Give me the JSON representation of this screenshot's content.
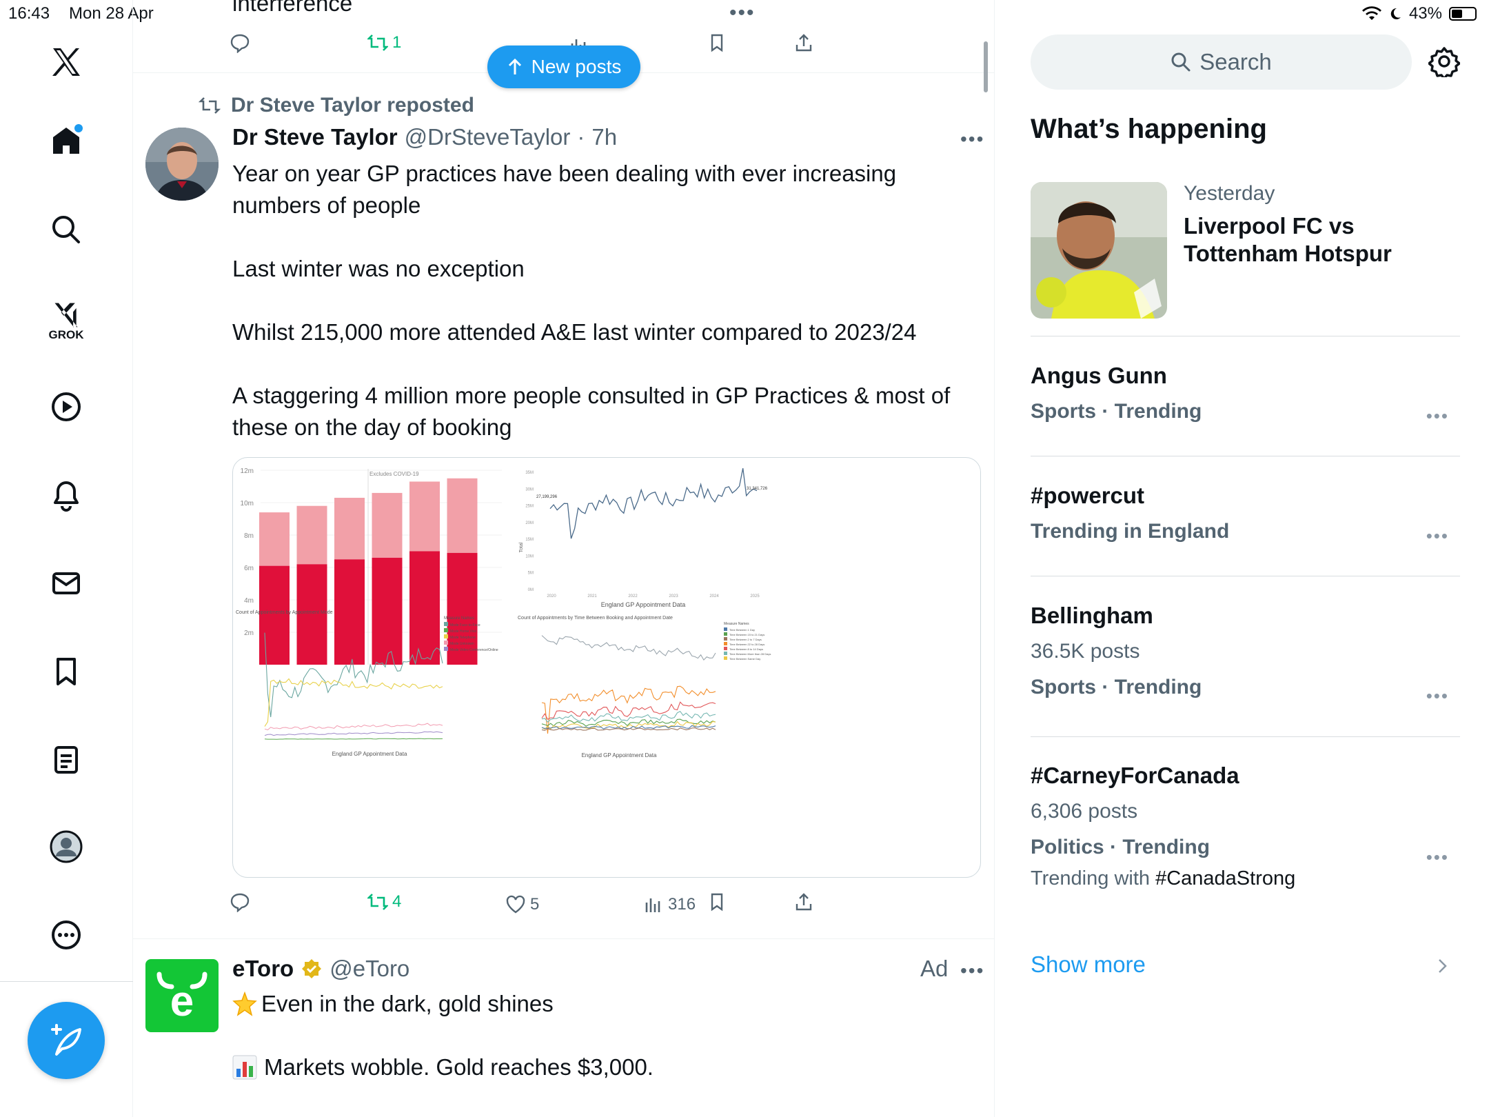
{
  "status": {
    "time": "16:43",
    "date": "Mon 28 Apr",
    "battery": "43%"
  },
  "nav": {
    "items": [
      "home",
      "explore",
      "grok",
      "videos",
      "notifications",
      "messages",
      "bookmarks",
      "lists",
      "profile",
      "more"
    ],
    "grok_label": "GROK"
  },
  "timeline": {
    "prev_tweet": {
      "text_tail": "interference",
      "retweets": "1"
    },
    "new_posts_label": "New posts",
    "tweet": {
      "repost_label": "Dr Steve Taylor reposted",
      "author_name": "Dr Steve Taylor",
      "author_handle": "@DrSteveTaylor",
      "time_sep": "·",
      "time": "7h",
      "para1": "Year on year GP practices have been dealing with ever increasing numbers of people",
      "para2": "Last winter was no exception",
      "para3": "Whilst 215,000 more attended A&E  last winter compared to 2023/24",
      "para4": "A staggering 4 million more people consulted in GP Practices & most of these on the day of booking",
      "retweets": "4",
      "likes": "5",
      "views": "316"
    },
    "ad": {
      "name": "eToro",
      "handle": "@eToro",
      "ad_label": "Ad",
      "line1": "Even in the dark, gold shines",
      "line2": "Markets wobble. Gold reaches $3,000."
    }
  },
  "media_charts": {
    "bar": {
      "y_ticks": [
        "12m",
        "10m",
        "8m",
        "6m",
        "4m",
        "2m"
      ],
      "annotation": "Excludes COVID-19",
      "values_lower": [
        6.1,
        6.2,
        6.5,
        6.6,
        7.0,
        6.9
      ],
      "values_total": [
        9.4,
        9.8,
        10.3,
        10.6,
        11.3,
        11.5
      ],
      "colors": {
        "lower": "#e0103a",
        "upper": "#f2a0a8"
      }
    },
    "line_total": {
      "y_ticks": [
        "35M",
        "30M",
        "25M",
        "20M",
        "15M",
        "10M",
        "5M",
        "0M"
      ],
      "x_ticks": [
        "2020",
        "2021",
        "2022",
        "2023",
        "2024",
        "2025"
      ],
      "ylabel": "Total",
      "xlabel": "England GP Appointment Data",
      "first_label": "27,199,296",
      "last_label": "31,341,726"
    },
    "line_mode": {
      "title": "Count of Appointments by Appointment Mode",
      "xlabel": "England GP Appointment Data",
      "legend_title": "Measure Names",
      "legend": [
        "Mode Face-to-Face",
        "Mode Home Visit",
        "Mode Telephone",
        "Mode Unknown",
        "Mode Video Conference/Online"
      ]
    },
    "line_time": {
      "title": "Count of Appointments by Time Between Booking and Appointment Date",
      "xlabel": "England GP Appointment Data",
      "legend_title": "Measure Names",
      "legend": [
        "Time Between 1 Day",
        "Time Between 15 to 21 Days",
        "Time Between 2 to 7 Days",
        "Time Between 22 to 28 Days",
        "Time Between 8 to 14 Days",
        "Time Between More than 28 Days",
        "Time Between Same Day"
      ]
    }
  },
  "sidebar": {
    "search_placeholder": "Search",
    "heading": "What’s happening",
    "featured": {
      "when": "Yesterday",
      "title": "Liverpool FC vs Tottenham Hotspur"
    },
    "trends": [
      {
        "title": "Angus Gunn",
        "meta": "Sports · Trending"
      },
      {
        "title": "#powercut",
        "meta": "Trending in England"
      },
      {
        "title": "Bellingham",
        "count": "36.5K posts",
        "meta": "Sports · Trending"
      },
      {
        "title": "#CarneyForCanada",
        "count": "6,306 posts",
        "meta": "Politics · Trending",
        "with_label": "Trending with",
        "with_tag": "#CanadaStrong"
      }
    ],
    "show_more": "Show more"
  },
  "colors": {
    "accent": "#1d9bf0",
    "repost_green": "#00ba7c",
    "etoro_green": "#13c636"
  }
}
